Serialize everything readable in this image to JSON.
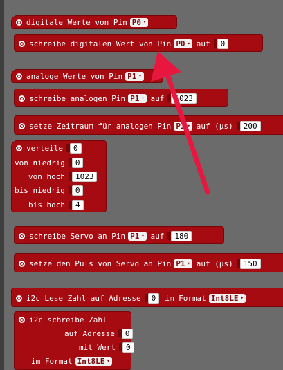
{
  "blocks": {
    "b1": {
      "label": "digitale Werte von Pin",
      "pin": "P0"
    },
    "b2": {
      "label": "schreibe digitalen Wert von Pin",
      "pin": "P0",
      "suffix": "auf",
      "value": "0"
    },
    "b3": {
      "label": "analoge Werte von Pin",
      "pin": "P1"
    },
    "b4": {
      "label": "schreibe analogen Pin",
      "pin": "P1",
      "suffix": "auf",
      "value": "1023"
    },
    "b5": {
      "label": "setze Zeitraum für analogen Pin",
      "pin": "P1",
      "suffix": "auf (µs)",
      "value": "200"
    },
    "b6": {
      "label": "verteile",
      "value": "0",
      "row2": {
        "label": "von niedrig",
        "value": "0"
      },
      "row3": {
        "label": "von hoch",
        "value": "1023"
      },
      "row4": {
        "label": "bis niedrig",
        "value": "0"
      },
      "row5": {
        "label": "bis hoch",
        "value": "4"
      }
    },
    "b7": {
      "label": "schreibe Servo an Pin",
      "pin": "P1",
      "suffix": "auf",
      "value": "180"
    },
    "b8": {
      "label": "setze den Puls von Servo an Pin",
      "pin": "P1",
      "suffix": "auf (µs)",
      "value": "150"
    },
    "b9": {
      "label": "i2c Lese Zahl auf Adresse",
      "value": "0",
      "suffix": "im Format",
      "format": "Int8LE"
    },
    "b10": {
      "label": "i2c schreibe Zahl",
      "row2": {
        "label": "auf Adresse",
        "value": "0"
      },
      "row3": {
        "label": "mit Wert",
        "value": "0"
      },
      "row4": {
        "label": "im Format",
        "format": "Int8LE"
      }
    }
  },
  "colors": {
    "block": "#a50b11",
    "background": "#6b6b6b",
    "annotation_arrow": "#e8173f"
  },
  "icons": {
    "dropdown": "▾",
    "block_icon": "gear-icon"
  }
}
